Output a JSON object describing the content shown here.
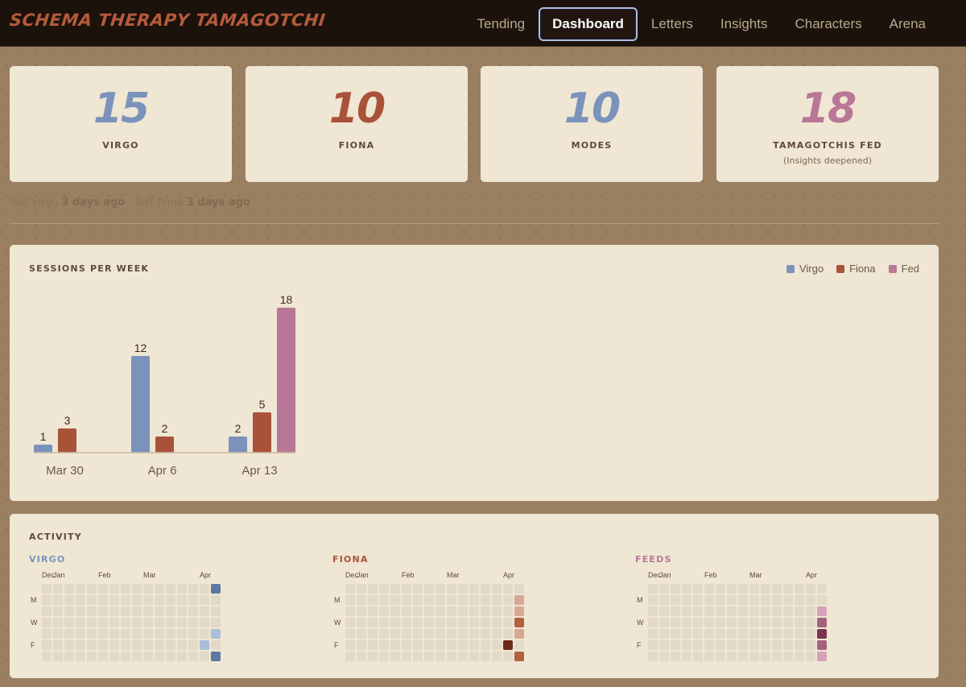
{
  "app": {
    "title": "SCHEMA THERAPY TAMAGOTCHI"
  },
  "nav": {
    "items": [
      {
        "label": "Tending",
        "active": false
      },
      {
        "label": "Dashboard",
        "active": true
      },
      {
        "label": "Letters",
        "active": false
      },
      {
        "label": "Insights",
        "active": false
      },
      {
        "label": "Characters",
        "active": false
      },
      {
        "label": "Arena",
        "active": false
      }
    ]
  },
  "stats": [
    {
      "value": "15",
      "label": "VIRGO",
      "sub": "",
      "color": "#7b93bb"
    },
    {
      "value": "10",
      "label": "FIONA",
      "sub": "",
      "color": "#a9523a"
    },
    {
      "value": "10",
      "label": "MODES",
      "sub": "",
      "color": "#7b93bb"
    },
    {
      "value": "18",
      "label": "TAMAGOTCHIS FED",
      "sub": "(Insights deepened)",
      "color": "#b97797"
    }
  ],
  "last_seen": {
    "virgo_prefix": "last virgo",
    "virgo_value": "3 days ago",
    "separator": "·",
    "fiona_prefix": "last fiona",
    "fiona_value": "3 days ago"
  },
  "sessions": {
    "title": "SESSIONS PER WEEK",
    "legend": [
      {
        "name": "Virgo",
        "color": "#7b93bb"
      },
      {
        "name": "Fiona",
        "color": "#a9523a"
      },
      {
        "name": "Fed",
        "color": "#b97797"
      }
    ]
  },
  "chart_data": {
    "type": "bar",
    "title": "SESSIONS PER WEEK",
    "categories": [
      "Mar 30",
      "Apr 6",
      "Apr 13"
    ],
    "series": [
      {
        "name": "Virgo",
        "color": "#7b93bb",
        "values": [
          1,
          12,
          2
        ]
      },
      {
        "name": "Fiona",
        "color": "#a9523a",
        "values": [
          3,
          2,
          5
        ]
      },
      {
        "name": "Fed",
        "color": "#b97797",
        "values": [
          null,
          null,
          18
        ]
      }
    ],
    "ylim": [
      0,
      18
    ],
    "legend": "top-right",
    "grid": false
  },
  "activity": {
    "title": "ACTIVITY",
    "row_labels": [
      "",
      "M",
      "",
      "W",
      "",
      "F",
      ""
    ],
    "heatmaps": [
      {
        "title": "VIRGO",
        "title_color": "#7b93bb",
        "months": [
          "Dec",
          "Jan",
          "Feb",
          "Mar",
          "Apr"
        ],
        "month_columns": [
          0,
          1,
          5,
          9,
          14
        ],
        "columns": 16,
        "cells": [
          {
            "col": 15,
            "row": 0,
            "color": "#5b77a4"
          },
          {
            "col": 15,
            "row": 4,
            "color": "#a9bfd9"
          },
          {
            "col": 14,
            "row": 5,
            "color": "#a9bfd9"
          },
          {
            "col": 15,
            "row": 6,
            "color": "#5b77a4"
          }
        ]
      },
      {
        "title": "FIONA",
        "title_color": "#a9523a",
        "months": [
          "Dec",
          "Jan",
          "Feb",
          "Mar",
          "Apr"
        ],
        "month_columns": [
          0,
          1,
          5,
          9,
          14
        ],
        "columns": 16,
        "cells": [
          {
            "col": 15,
            "row": 1,
            "color": "#d8a796"
          },
          {
            "col": 15,
            "row": 2,
            "color": "#d8a796"
          },
          {
            "col": 15,
            "row": 3,
            "color": "#b3603f"
          },
          {
            "col": 15,
            "row": 4,
            "color": "#d8a796"
          },
          {
            "col": 14,
            "row": 5,
            "color": "#6c2b1a"
          },
          {
            "col": 15,
            "row": 6,
            "color": "#b3603f"
          }
        ]
      },
      {
        "title": "FEEDS",
        "title_color": "#b97797",
        "months": [
          "Dec",
          "Jan",
          "Feb",
          "Mar",
          "Apr"
        ],
        "month_columns": [
          0,
          1,
          5,
          9,
          14
        ],
        "columns": 16,
        "cells": [
          {
            "col": 15,
            "row": 2,
            "color": "#d5a2ba"
          },
          {
            "col": 15,
            "row": 3,
            "color": "#a6617f"
          },
          {
            "col": 15,
            "row": 4,
            "color": "#7a3452"
          },
          {
            "col": 15,
            "row": 5,
            "color": "#a6617f"
          },
          {
            "col": 15,
            "row": 6,
            "color": "#d5a2ba"
          }
        ]
      }
    ]
  }
}
